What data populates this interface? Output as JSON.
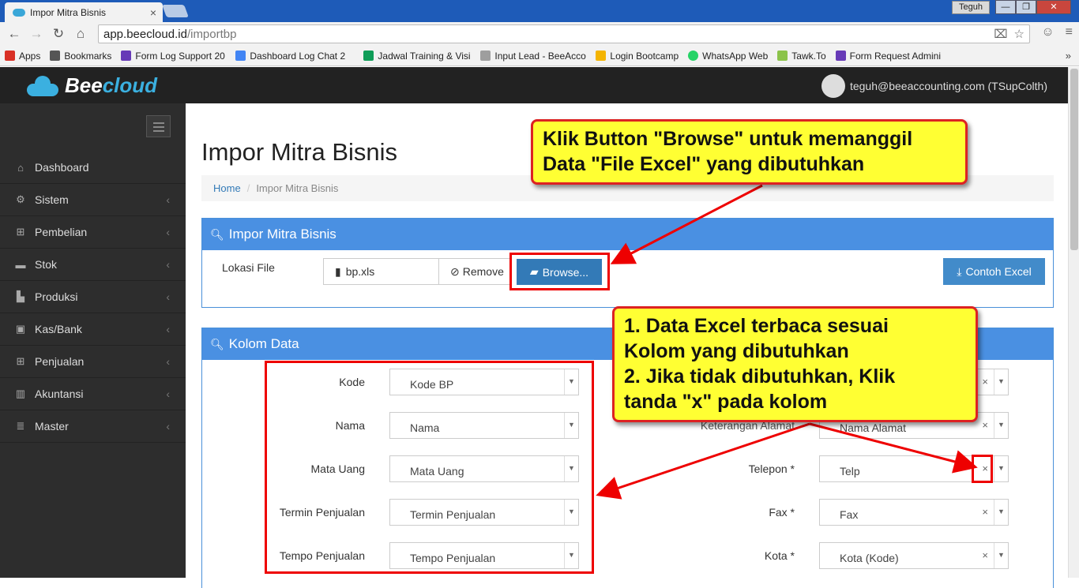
{
  "browser": {
    "tab_title": "Impor Mitra Bisnis",
    "tab_close": "×",
    "window_user": "Teguh",
    "win_minimize": "—",
    "win_maximize": "❐",
    "win_close": "✕",
    "url_host": "app.beecloud.id",
    "url_path": "/importbp"
  },
  "bookmarks": [
    {
      "label": "Apps",
      "color": "#d93025"
    },
    {
      "label": "Bookmarks",
      "color": "#555555"
    },
    {
      "label": "Form Log Support 20",
      "color": "#673ab7"
    },
    {
      "label": "Dashboard Log Chat 2",
      "color": "#4285f4"
    },
    {
      "label": "Jadwal Training & Visi",
      "color": "#0f9d58"
    },
    {
      "label": "Input Lead - BeeAccou",
      "color": "#9e9e9e"
    },
    {
      "label": "Login Bootcamp",
      "color": "#f4b400"
    },
    {
      "label": "WhatsApp Web",
      "color": "#25d366"
    },
    {
      "label": "Tawk.To",
      "color": "#8bc34a"
    },
    {
      "label": "Form Request Admini",
      "color": "#673ab7"
    }
  ],
  "app": {
    "brand_part1": "Bee",
    "brand_part2": "cloud",
    "user_label": "teguh@beeaccounting.com (TSupColth)"
  },
  "sidebar": {
    "items": [
      {
        "label": "Dashboard",
        "icon": "home-icon",
        "glyph": "⌂",
        "chev": ""
      },
      {
        "label": "Sistem",
        "icon": "cogs-icon",
        "glyph": "⚙",
        "chev": "‹"
      },
      {
        "label": "Pembelian",
        "icon": "cart-icon",
        "glyph": "🛒",
        "chev": "‹"
      },
      {
        "label": "Stok",
        "icon": "box-icon",
        "glyph": "▬",
        "chev": "‹"
      },
      {
        "label": "Produksi",
        "icon": "industry-icon",
        "glyph": "▙",
        "chev": "‹"
      },
      {
        "label": "Kas/Bank",
        "icon": "money-icon",
        "glyph": "▣",
        "chev": "‹"
      },
      {
        "label": "Penjualan",
        "icon": "cart-icon",
        "glyph": "🛒",
        "chev": "‹"
      },
      {
        "label": "Akuntansi",
        "icon": "bar-chart-icon",
        "glyph": "▥",
        "chev": "‹"
      },
      {
        "label": "Master",
        "icon": "database-icon",
        "glyph": "≣",
        "chev": "‹"
      }
    ]
  },
  "page": {
    "title": "Impor Mitra Bisnis",
    "breadcrumb_home": "Home",
    "breadcrumb_sep": "/",
    "breadcrumb_current": "Impor Mitra Bisnis"
  },
  "import_panel": {
    "heading": "Impor Mitra Bisnis",
    "file_label": "Lokasi File",
    "file_name": "bp.xls",
    "remove_label": "Remove",
    "browse_label": "Browse...",
    "sample_label": "Contoh Excel"
  },
  "columns_panel": {
    "heading": "Kolom Data",
    "left_fields": [
      {
        "label": "Kode",
        "value": "Kode BP"
      },
      {
        "label": "Nama",
        "value": "Nama"
      },
      {
        "label": "Mata Uang",
        "value": "Mata Uang"
      },
      {
        "label": "Termin Penjualan",
        "value": "Termin Penjualan"
      },
      {
        "label": "Tempo Penjualan",
        "value": "Tempo Penjualan"
      }
    ],
    "right_fields": [
      {
        "label": "",
        "value": ""
      },
      {
        "label": "Keterangan Alamat",
        "value": "Nama Alamat"
      },
      {
        "label": "Telepon *",
        "value": "Telp"
      },
      {
        "label": "Fax *",
        "value": "Fax"
      },
      {
        "label": "Kota *",
        "value": "Kota (Kode)"
      }
    ],
    "clear_glyph": "×",
    "arrow_glyph": "▼"
  },
  "annotations": {
    "callout1_line1": "Klik Button \"Browse\" untuk memanggil",
    "callout1_line2": "Data \"File Excel\" yang dibutuhkan",
    "callout2_line1": "1. Data Excel terbaca sesuai",
    "callout2_line2": "Kolom yang dibutuhkan",
    "callout2_line3": "2. Jika tidak dibutuhkan, Klik",
    "callout2_line4": "tanda \"x\" pada kolom",
    "color": "#ffff33",
    "border_color": "#dd2222"
  }
}
